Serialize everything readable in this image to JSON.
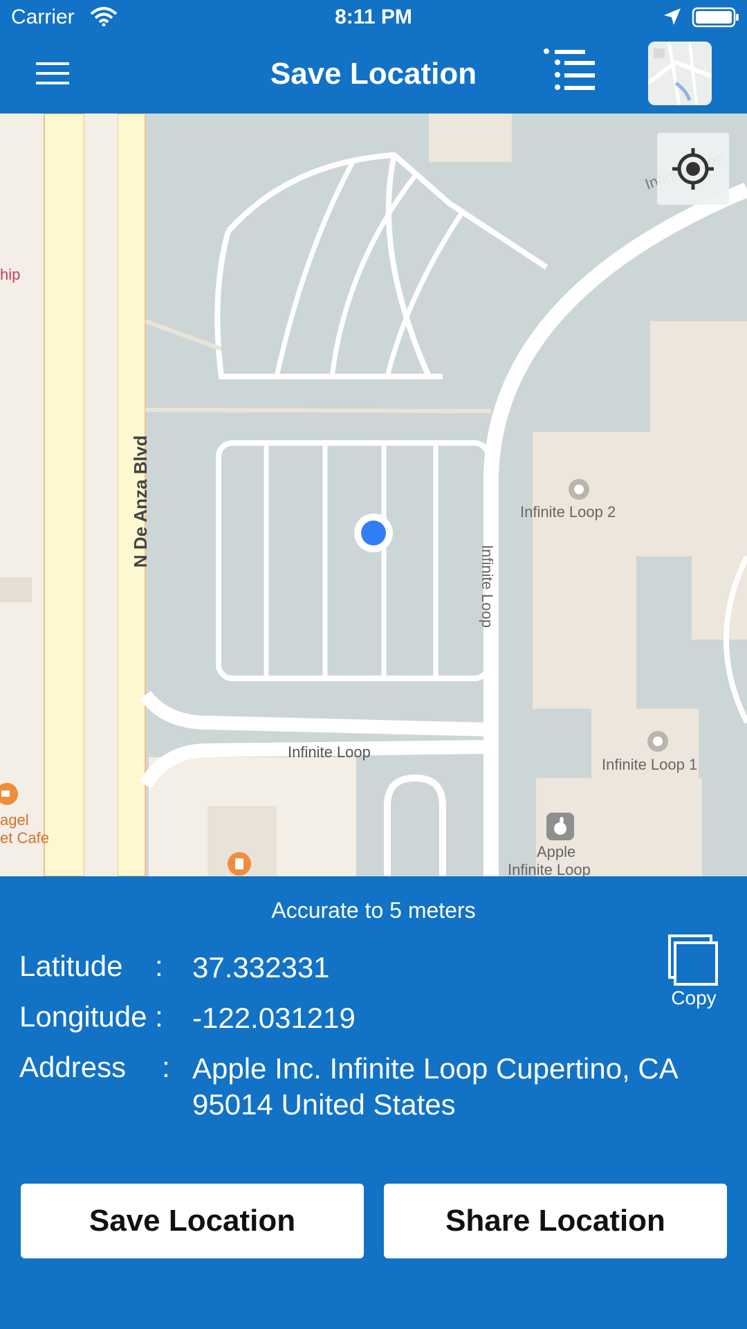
{
  "status_bar": {
    "carrier": "Carrier",
    "time": "8:11 PM"
  },
  "nav": {
    "title": "Save Location"
  },
  "map": {
    "street_labels": {
      "de_anza": "N De Anza Blvd",
      "infinite_loop_vertical": "Infinite Loop",
      "infinite_loop_bottom": "Infinite Loop",
      "infinite_loop_top_right": "Infinite Loop"
    },
    "poi_labels": {
      "partial_left": "hip",
      "loop2": "Infinite Loop 2",
      "loop1": "Infinite Loop 1",
      "apple_line1": "Apple",
      "apple_line2": "Infinite Loop",
      "cafe_line1": "agel",
      "cafe_line2": "et Cafe"
    }
  },
  "info": {
    "accuracy": "Accurate to 5 meters",
    "latitude_label": "Latitude",
    "latitude_value": "37.332331",
    "longitude_label": "Longitude :",
    "longitude_value": "-122.031219",
    "address_label": "Address",
    "address_value": "Apple Inc. Infinite Loop Cupertino, CA 95014 United States",
    "colon": ":",
    "copy_label": "Copy"
  },
  "actions": {
    "save_label": "Save Location",
    "share_label": "Share Location"
  },
  "colors": {
    "primary": "#1172c6",
    "user_dot": "#2f7ef5",
    "map_bg": "#cdd6d6",
    "building": "#ece6dc",
    "road_major": "#fdf8cf"
  }
}
